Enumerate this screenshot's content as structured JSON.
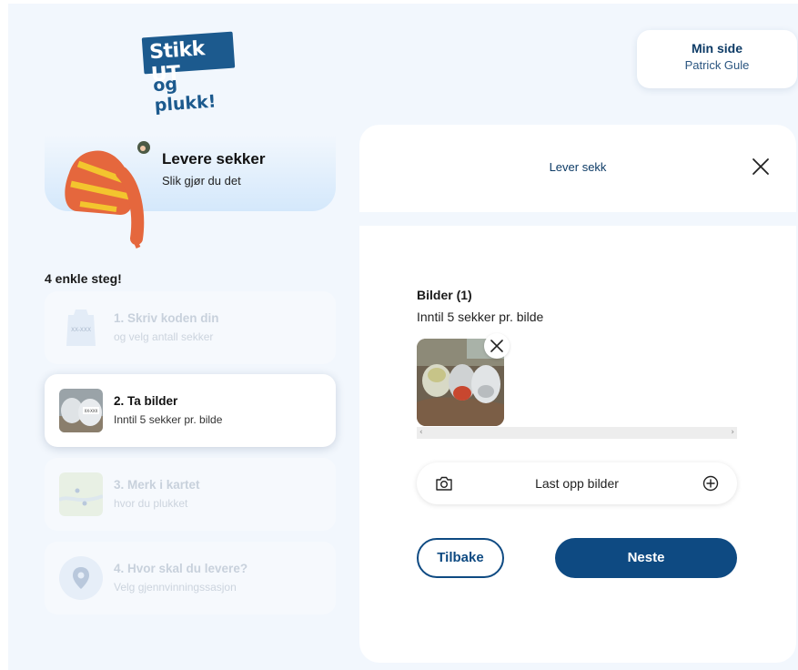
{
  "logo": {
    "line1": "Stikk UT",
    "line2": "og plukk!"
  },
  "account": {
    "title": "Min side",
    "user": "Patrick Gule"
  },
  "banner": {
    "title": "Levere sekker",
    "subtitle": "Slik gjør du det"
  },
  "steps": {
    "heading": "4 enkle steg!",
    "items": [
      {
        "label": "1. Skriv koden din",
        "sub": "og velg antall sekker",
        "state": "inactive",
        "icon": "bag-code-icon",
        "thumb_text": "XX-XXX"
      },
      {
        "label": "2. Ta bilder",
        "sub": "Inntil 5 sekker pr. bilde",
        "state": "active",
        "icon": "bags-photo-thumbnail",
        "thumb_text": "XX-XXX"
      },
      {
        "label": "3. Merk i kartet",
        "sub": "hvor du plukket",
        "state": "inactive",
        "icon": "map-icon"
      },
      {
        "label": "4. Hvor skal du levere?",
        "sub": "Velg gjennvinningssasjon",
        "state": "inactive",
        "icon": "location-pin-icon"
      }
    ]
  },
  "panel": {
    "header_title": "Lever sekk",
    "images_title": "Bilder (1)",
    "images_subtitle": "Inntil 5 sekker pr. bilde",
    "images": [
      {
        "name": "bags-photo"
      }
    ],
    "upload_label": "Last opp bilder",
    "back_label": "Tilbake",
    "next_label": "Neste"
  },
  "colors": {
    "brand": "#0e4a82",
    "brand_dark": "#0d3b66",
    "page_background": "#f2f7fd"
  }
}
